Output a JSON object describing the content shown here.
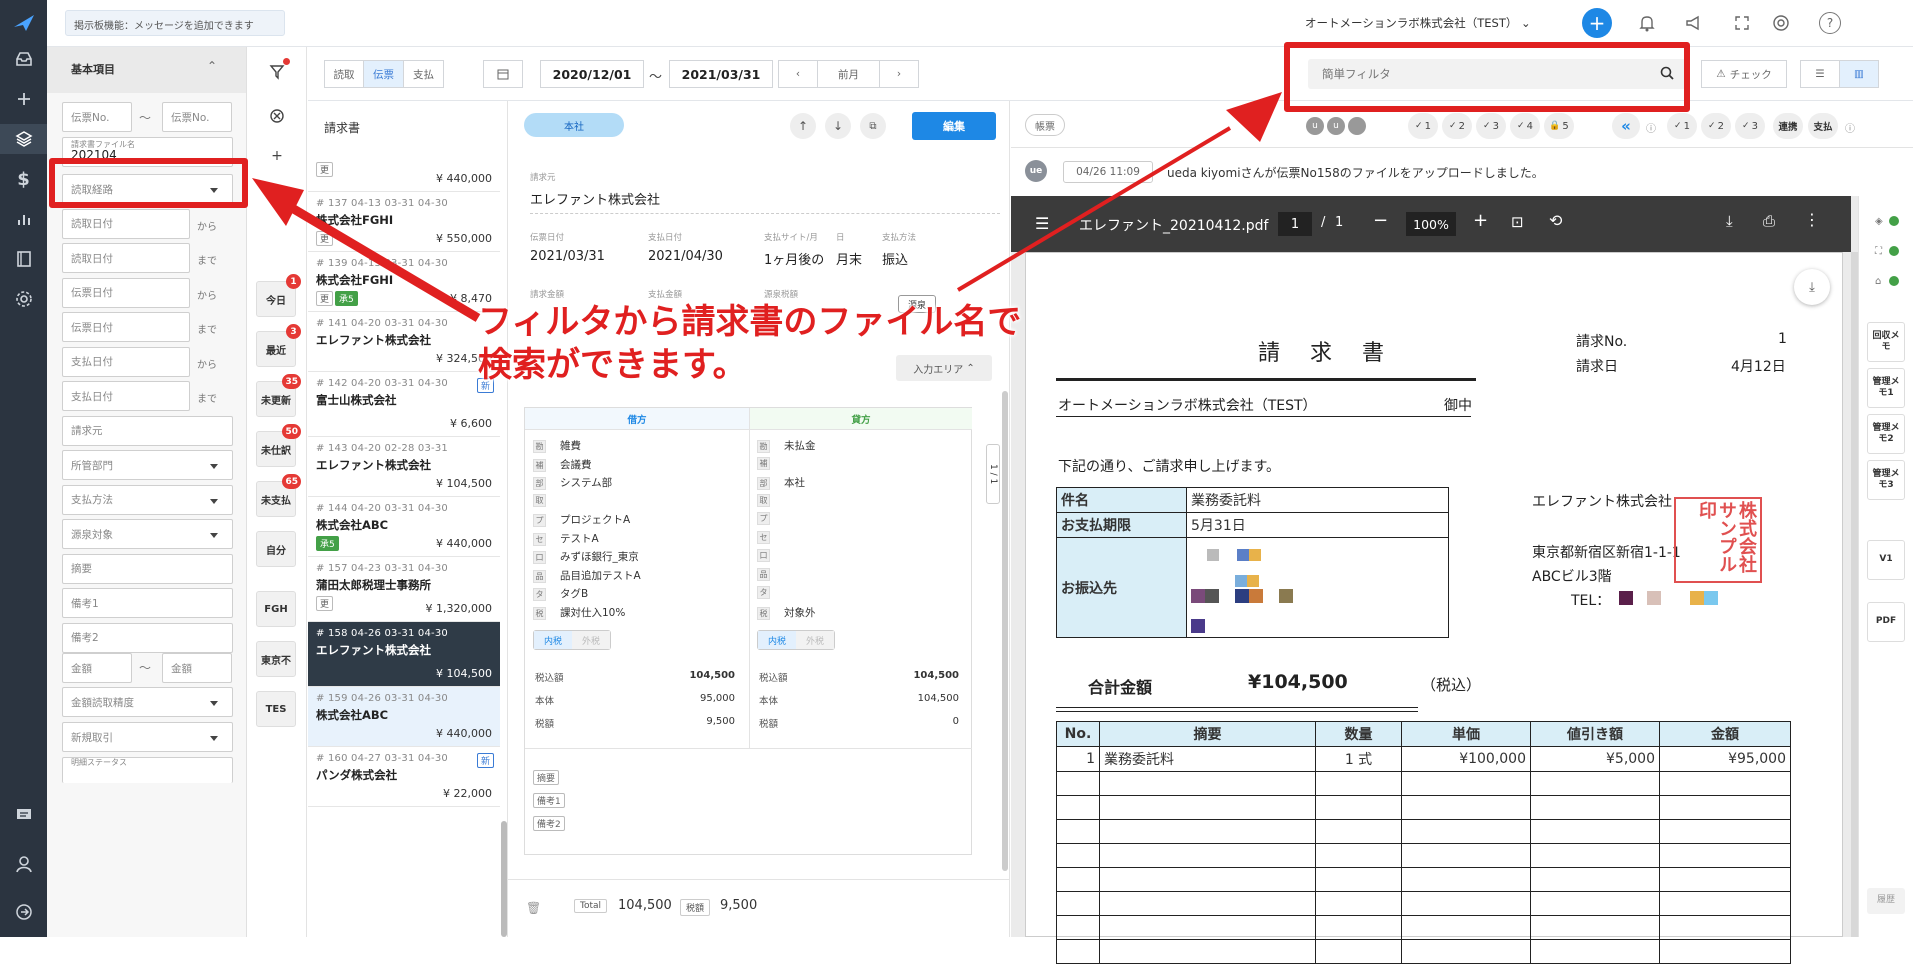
{
  "top": {
    "notice": "掲示板機能：メッセージを追加できます",
    "company": "オートメーションラボ株式会社（TEST）"
  },
  "filter": {
    "section_title": "基本項目",
    "denpyo_no_from": "伝票No.",
    "tilde": "〜",
    "denpyo_no_to": "伝票No.",
    "file_name_label": "請求書ファイル名",
    "file_name_value": "202104",
    "fields": [
      {
        "label": "読取経路",
        "suffix": ""
      },
      {
        "label": "読取日付",
        "suffix": "から"
      },
      {
        "label": "読取日付",
        "suffix": "まで"
      },
      {
        "label": "伝票日付",
        "suffix": "から"
      },
      {
        "label": "伝票日付",
        "suffix": "まで"
      },
      {
        "label": "支払日付",
        "suffix": "から"
      },
      {
        "label": "支払日付",
        "suffix": "まで"
      },
      {
        "label": "請求元",
        "suffix": ""
      },
      {
        "label": "所管部門",
        "suffix": ""
      },
      {
        "label": "支払方法",
        "suffix": ""
      },
      {
        "label": "源泉対象",
        "suffix": ""
      },
      {
        "label": "摘要",
        "suffix": ""
      },
      {
        "label": "備考1",
        "suffix": ""
      },
      {
        "label": "備考2",
        "suffix": ""
      }
    ],
    "amount_from": "金額",
    "amount_to": "金額",
    "amount_precision": "金額読取精度",
    "new_deal": "新規取引",
    "status_label": "明細ステータス"
  },
  "quick": [
    {
      "label": "今日",
      "badge": "1"
    },
    {
      "label": "最近",
      "badge": "3"
    },
    {
      "label": "未更新",
      "badge": "35"
    },
    {
      "label": "未仕訳",
      "badge": "50"
    },
    {
      "label": "未支払",
      "badge": "65"
    },
    {
      "label": "自分",
      "badge": ""
    },
    {
      "label": "FGH",
      "badge": ""
    },
    {
      "label": "東京不",
      "badge": ""
    },
    {
      "label": "TES",
      "badge": ""
    }
  ],
  "toolbar": {
    "tabs": [
      "読取",
      "伝票",
      "支払"
    ],
    "date_from": "2020/12/01",
    "date_sep": "〜",
    "date_to": "2021/03/31",
    "prev_month": "前月",
    "search_placeholder": "簡単フィルタ",
    "check": "チェック"
  },
  "list": {
    "title": "請求書",
    "items": [
      {
        "meta": "",
        "name": "",
        "amount": "¥ 440,000",
        "tags": [
          "更"
        ]
      },
      {
        "meta": "# 137  04-13  03-31  04-30",
        "name": "株式会社FGHI",
        "amount": "¥ 550,000",
        "tags": [
          "更"
        ]
      },
      {
        "meta": "# 139  04-13  03-31  04-30",
        "name": "株式会社FGHI",
        "amount": "¥ 8,470",
        "tags": [
          "更",
          "承5"
        ]
      },
      {
        "meta": "# 141  04-20  03-31  04-30",
        "name": "エレファント株式会社",
        "amount": "¥ 324,500",
        "tags": []
      },
      {
        "meta": "# 142  04-20  03-31  04-30",
        "name": "富士山株式会社",
        "amount": "¥ 6,600",
        "tags": [
          "新"
        ]
      },
      {
        "meta": "# 143  04-20  02-28  03-31",
        "name": "エレファント株式会社",
        "amount": "¥ 104,500",
        "tags": []
      },
      {
        "meta": "# 144  04-20  03-31  04-30",
        "name": "株式会社ABC",
        "amount": "¥ 440,000",
        "tags": [
          "承5"
        ]
      },
      {
        "meta": "# 157  04-23  03-31  04-30",
        "name": "蒲田太郎税理士事務所",
        "amount": "¥ 1,320,000",
        "tags": [
          "更"
        ]
      },
      {
        "meta": "# 158  04-26  03-31  04-30",
        "name": "エレファント株式会社",
        "amount": "¥ 104,500",
        "tags": []
      },
      {
        "meta": "# 159  04-26  03-31  04-30",
        "name": "株式会社ABC",
        "amount": "¥ 440,000",
        "tags": []
      },
      {
        "meta": "# 160  04-27  03-31  04-30",
        "name": "パンダ株式会社",
        "amount": "¥ 22,000",
        "tags": [
          "新"
        ]
      }
    ]
  },
  "detail": {
    "branch": "本社",
    "edit": "編集",
    "billing_from_label": "請求元",
    "billing_from": "エレファント株式会社",
    "denpyo_date_label": "伝票日付",
    "denpyo_date": "2021/03/31",
    "pay_date_label": "支払日付",
    "pay_date": "2021/04/30",
    "pay_site_label": "支払サイト/月",
    "pay_site": "1ヶ月後の",
    "day_label": "日",
    "day": "月末",
    "method_label": "支払方法",
    "method": "振込",
    "amount_label": "請求金額",
    "tax_label": "支払金額",
    "withholding_label": "源泉税額",
    "gensen": "源泉",
    "input_area": "入力エリア",
    "debit": "借方",
    "credit": "貸方",
    "debit_rows": [
      [
        "勘",
        "雑費"
      ],
      [
        "補",
        "会議費"
      ],
      [
        "部",
        "システム部"
      ],
      [
        "取",
        ""
      ],
      [
        "プ",
        "プロジェクトA"
      ],
      [
        "セ",
        "テストA"
      ],
      [
        "口",
        "みずほ銀行_東京"
      ],
      [
        "品",
        "品目追加テストA"
      ],
      [
        "タ",
        "タグB"
      ],
      [
        "税",
        "課対仕入10%"
      ]
    ],
    "credit_rows": [
      [
        "勘",
        "未払金"
      ],
      [
        "補",
        ""
      ],
      [
        "部",
        "本社"
      ],
      [
        "取",
        ""
      ],
      [
        "プ",
        ""
      ],
      [
        "セ",
        ""
      ],
      [
        "口",
        ""
      ],
      [
        "品",
        ""
      ],
      [
        "タ",
        ""
      ],
      [
        "税",
        "対象外"
      ]
    ],
    "tax_in": "内税",
    "tax_out": "外税",
    "debit_totals": [
      [
        "税込額",
        "104,500"
      ],
      [
        "本体",
        "95,000"
      ],
      [
        "税額",
        "9,500"
      ]
    ],
    "credit_totals": [
      [
        "税込額",
        "104,500"
      ],
      [
        "本体",
        "104,500"
      ],
      [
        "税額",
        "0"
      ]
    ],
    "memo": [
      "摘要",
      "備考1",
      "備考2"
    ],
    "total_label": "Total",
    "total_value": "104,500",
    "tax_total_label": "税額",
    "tax_total_value": "9,500",
    "page_indicator": "1 / 1"
  },
  "right_top": {
    "chohyo": "帳票",
    "checks": [
      "1",
      "2",
      "3",
      "4",
      "5"
    ],
    "checks2": [
      "1",
      "2",
      "3"
    ],
    "renkei": "連携",
    "shiharai": "支払"
  },
  "activity": {
    "avatar": "ue",
    "time": "04/26 11:09",
    "text": "ueda kiyomiさんが伝票No158のファイルをアップロードしました。"
  },
  "pdf": {
    "filename": "エレファント_20210412.pdf",
    "page": "1",
    "pages": "1",
    "zoom": "100%",
    "title": "請　求　書",
    "no_label": "請求No.",
    "no_value": "1",
    "date_label": "請求日",
    "date_value": "4月12日",
    "recipient": "オートメーションラボ株式会社（TEST）",
    "onchu": "御中",
    "greeting": "下記の通り、ご請求申し上げます。",
    "info_rows": [
      [
        "件名",
        "業務委託料"
      ],
      [
        "お支払期限",
        "5月31日"
      ],
      [
        "お振込先",
        ""
      ]
    ],
    "sender_name": "エレファント株式会社",
    "sender_addr": "東京都新宿区新宿1-1-1",
    "sender_bldg": "ABCビル3階",
    "sender_tel": "TEL：",
    "seal": "株式会社サンプル印",
    "total_label": "合計金額",
    "total_value": "¥104,500",
    "total_tax": "（税込）",
    "item_headers": [
      "No.",
      "摘要",
      "数量",
      "単価",
      "値引き額",
      "金額"
    ],
    "item_rows": [
      [
        "1",
        "業務委託料",
        "1 式",
        "¥100,000",
        "¥5,000",
        "¥95,000"
      ]
    ]
  },
  "right_col": [
    "回収メモ",
    "管理メモ1",
    "管理メモ2",
    "管理メモ3",
    "V1",
    "PDF",
    "履歴"
  ],
  "annotation": {
    "line1": "フィルタから請求書のファイル名で",
    "line2": "検索ができます。"
  },
  "colors": {
    "accent": "#1e88e5",
    "red": "#e02020",
    "dark": "#2b3440"
  }
}
